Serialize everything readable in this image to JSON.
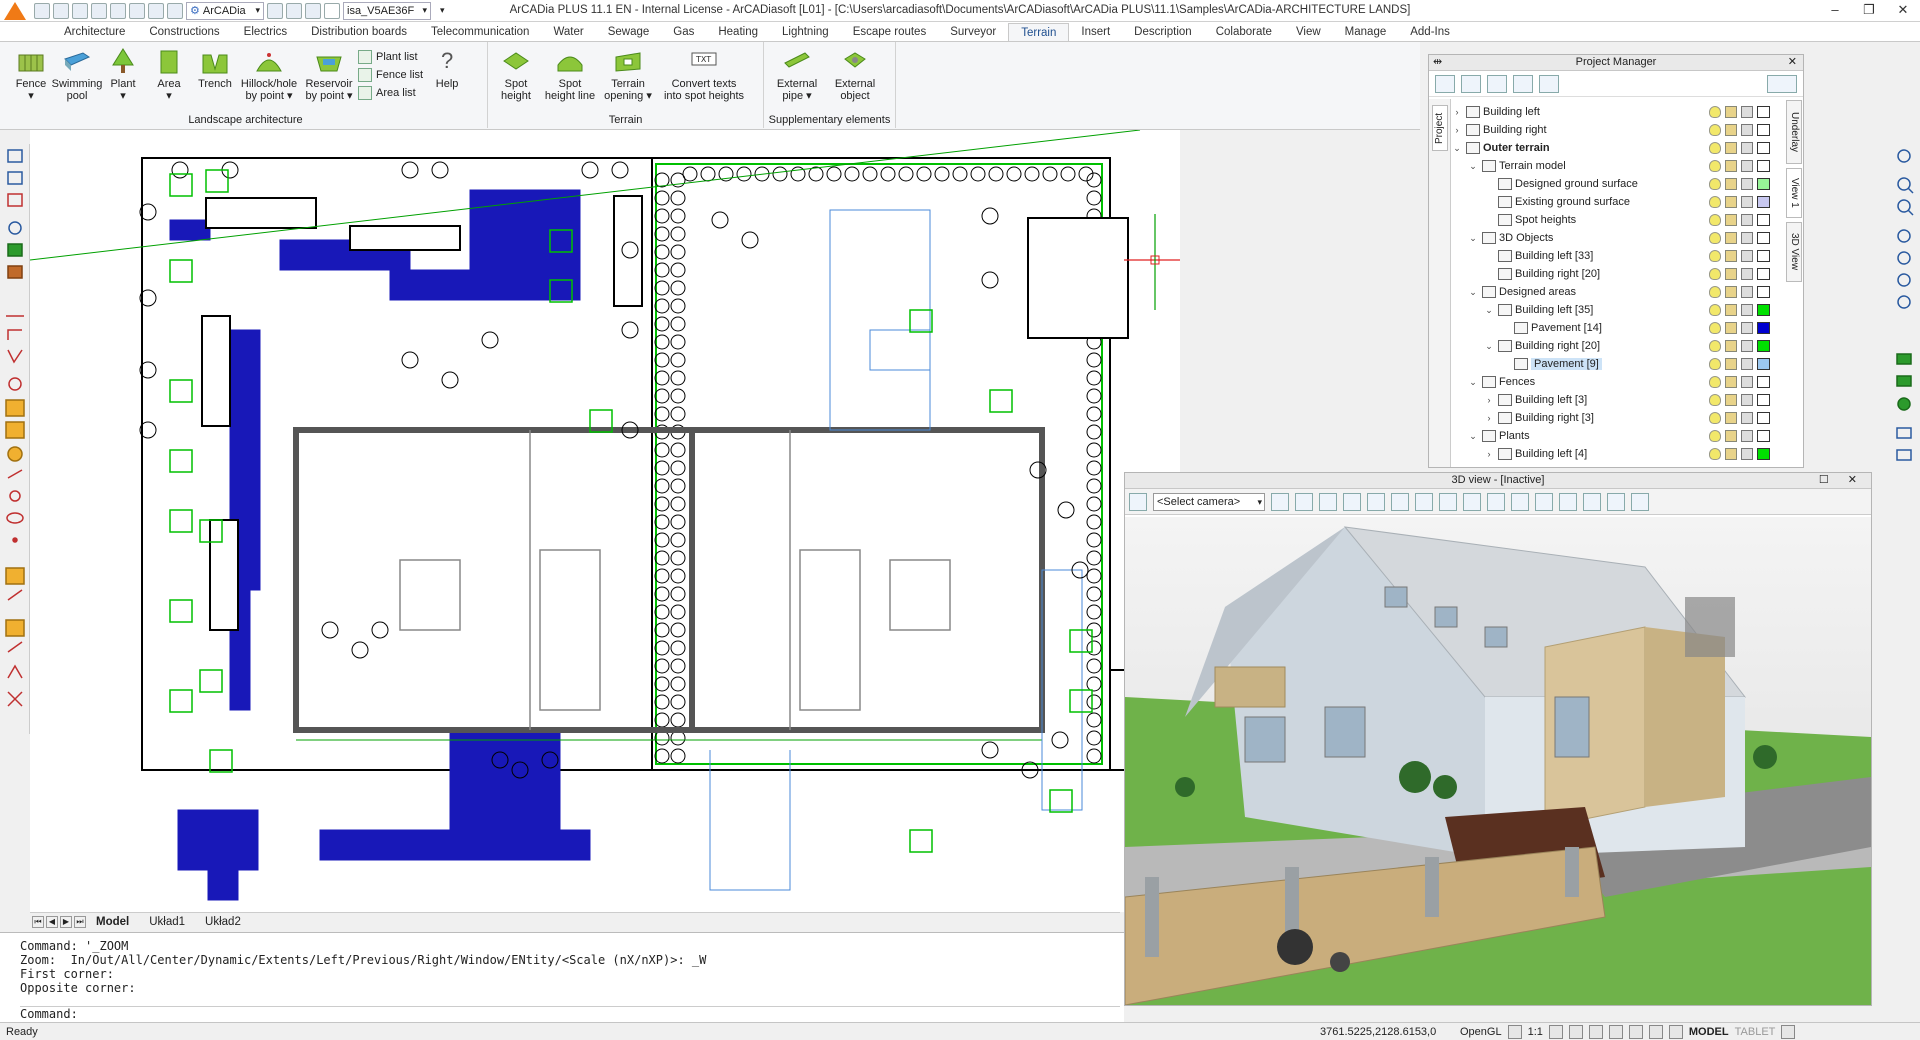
{
  "app": {
    "title": "ArCADia PLUS 11.1 EN - Internal License - ArCADiasoft [L01] - [C:\\Users\\arcadiasoft\\Documents\\ArCADiasoft\\ArCADia PLUS\\11.1\\Samples\\ArCADia-ARCHITECTURE LANDS]",
    "workspace_combo": "ArCADia",
    "layer_combo": "isa_V5AE36F",
    "window_controls": [
      "–",
      "❐",
      "✕"
    ]
  },
  "menu": {
    "tabs": [
      "Architecture",
      "Constructions",
      "Electrics",
      "Distribution boards",
      "Telecommunication",
      "Water",
      "Sewage",
      "Gas",
      "Heating",
      "Lightning",
      "Escape routes",
      "Surveyor",
      "Terrain",
      "Insert",
      "Description",
      "Colaborate",
      "View",
      "Manage",
      "Add-Ins"
    ],
    "active": "Terrain"
  },
  "ribbon": {
    "landscape": {
      "label": "Landscape architecture",
      "buttons": [
        {
          "l1": "Fence",
          "l2": "▾"
        },
        {
          "l1": "Swimming",
          "l2": "pool"
        },
        {
          "l1": "Plant",
          "l2": "▾"
        },
        {
          "l1": "Area",
          "l2": "▾"
        },
        {
          "l1": "Trench",
          "l2": ""
        },
        {
          "l1": "Hillock/hole",
          "l2": "by point ▾"
        },
        {
          "l1": "Reservoir",
          "l2": "by point ▾"
        }
      ],
      "lists": [
        "Plant list",
        "Fence list",
        "Area list"
      ],
      "help": "Help"
    },
    "terrain": {
      "label": "Terrain",
      "buttons": [
        {
          "l1": "Spot",
          "l2": "height"
        },
        {
          "l1": "Spot",
          "l2": "height line"
        },
        {
          "l1": "Terrain",
          "l2": "opening ▾"
        },
        {
          "l1": "Convert texts",
          "l2": "into spot heights"
        }
      ]
    },
    "supplementary": {
      "label": "Supplementary elements",
      "buttons": [
        {
          "l1": "External",
          "l2": "pipe ▾"
        },
        {
          "l1": "External",
          "l2": "object"
        }
      ]
    }
  },
  "layout_tabs": [
    "Model",
    "Układ1",
    "Układ2"
  ],
  "command_line": {
    "lines": [
      "Command: '_ZOOM",
      "Zoom:  In/Out/All/Center/Dynamic/Extents/Left/Previous/Right/Window/ENtity/<Scale (nX/nXP)>: _W",
      "First corner:",
      "Opposite corner:"
    ],
    "prompt": "Command:"
  },
  "status": {
    "ready": "Ready",
    "coords": "3761.5225,2128.6153,0",
    "opengl": "OpenGL",
    "scale": "1:1",
    "model": "MODEL",
    "tablet": "TABLET"
  },
  "project_manager": {
    "title": "Project Manager",
    "side_tab": "Project",
    "right_tabs": [
      "Underlay",
      "View 1",
      "3D View"
    ],
    "tree": [
      {
        "level": 0,
        "exp": "›",
        "label": "Building left",
        "bold": false,
        "color": "#ffffff",
        "sel": false
      },
      {
        "level": 0,
        "exp": "›",
        "label": "Building right",
        "bold": false,
        "color": "#ffffff",
        "sel": false
      },
      {
        "level": 0,
        "exp": "⌄",
        "label": "Outer terrain",
        "bold": true,
        "color": "#ffffff",
        "sel": false
      },
      {
        "level": 1,
        "exp": "⌄",
        "label": "Terrain model",
        "bold": false,
        "color": "#ffffff",
        "sel": false
      },
      {
        "level": 2,
        "exp": "",
        "label": "Designed ground surface",
        "bold": false,
        "color": "#98f598",
        "sel": false
      },
      {
        "level": 2,
        "exp": "",
        "label": "Existing ground surface",
        "bold": false,
        "color": "#c8c8f0",
        "sel": false
      },
      {
        "level": 2,
        "exp": "",
        "label": "Spot heights",
        "bold": false,
        "color": "#ffffff",
        "sel": false
      },
      {
        "level": 1,
        "exp": "⌄",
        "label": "3D Objects",
        "bold": false,
        "color": "#ffffff",
        "sel": false
      },
      {
        "level": 2,
        "exp": "",
        "label": "Building left [33]",
        "bold": false,
        "color": "#ffffff",
        "sel": false
      },
      {
        "level": 2,
        "exp": "",
        "label": "Building right [20]",
        "bold": false,
        "color": "#ffffff",
        "sel": false
      },
      {
        "level": 1,
        "exp": "⌄",
        "label": "Designed areas",
        "bold": false,
        "color": "#ffffff",
        "sel": false
      },
      {
        "level": 2,
        "exp": "⌄",
        "label": "Building left [35]",
        "bold": false,
        "color": "#00e000",
        "sel": false
      },
      {
        "level": 3,
        "exp": "",
        "label": "Pavement [14]",
        "bold": false,
        "color": "#0000d0",
        "sel": false
      },
      {
        "level": 2,
        "exp": "⌄",
        "label": "Building right [20]",
        "bold": false,
        "color": "#00e000",
        "sel": false
      },
      {
        "level": 3,
        "exp": "",
        "label": "Pavement [9]",
        "bold": false,
        "color": "#9cc8f0",
        "sel": true
      },
      {
        "level": 1,
        "exp": "⌄",
        "label": "Fences",
        "bold": false,
        "color": "#ffffff",
        "sel": false
      },
      {
        "level": 2,
        "exp": "›",
        "label": "Building left [3]",
        "bold": false,
        "color": "#ffffff",
        "sel": false
      },
      {
        "level": 2,
        "exp": "›",
        "label": "Building right [3]",
        "bold": false,
        "color": "#ffffff",
        "sel": false
      },
      {
        "level": 1,
        "exp": "⌄",
        "label": "Plants",
        "bold": false,
        "color": "#ffffff",
        "sel": false
      },
      {
        "level": 2,
        "exp": "›",
        "label": "Building left [4]",
        "bold": false,
        "color": "#00e000",
        "sel": false
      }
    ]
  },
  "view3d": {
    "title": "3D view - [Inactive]",
    "camera": "<Select camera>",
    "window_controls": "☐ ✕"
  },
  "colors": {
    "accent": "#1f4f8f",
    "plan_blue": "#1818b8",
    "plan_green": "#00c000",
    "logo": "#f07a16"
  }
}
